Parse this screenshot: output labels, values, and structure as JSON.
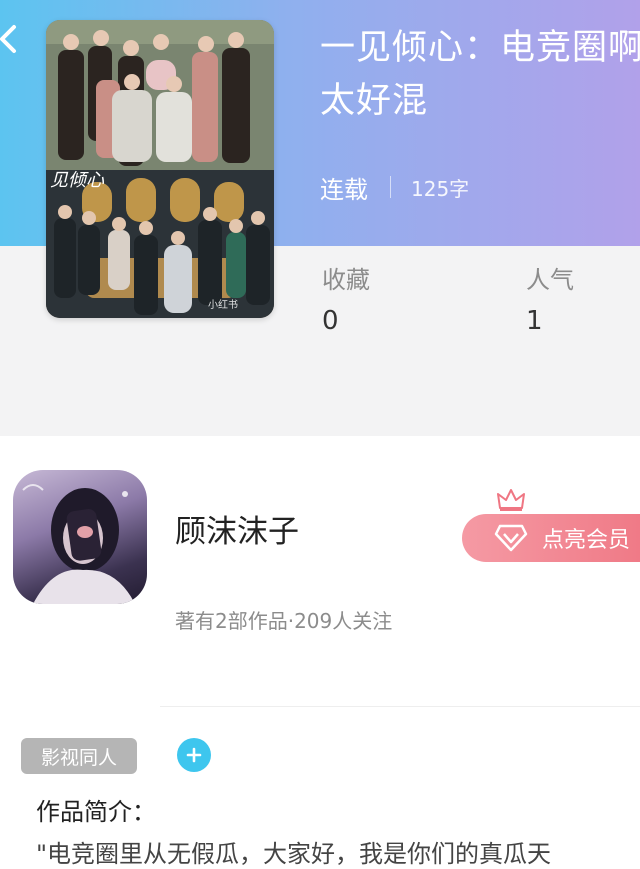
{
  "header": {
    "back_icon": "chevron-left-icon",
    "title": "一见倾心：电竞圈啊太好混",
    "status": "连载",
    "word_count": "125字"
  },
  "cover": {
    "calligraphy_text": "见倾心",
    "watermark": "小红书"
  },
  "stats": {
    "favorites_label": "收藏",
    "favorites_value": "0",
    "popularity_label": "人气",
    "popularity_value": "1"
  },
  "author": {
    "name": "顾沫沫子",
    "meta": "著有2部作品·209人关注",
    "vip_label": "点亮会员",
    "vip_icons": [
      "crown-icon",
      "diamond-icon"
    ]
  },
  "tags": {
    "items": [
      "影视同人"
    ],
    "add_icon": "plus-icon"
  },
  "intro": {
    "heading": "作品简介：",
    "text": "\"电竞圈里从无假瓜，大家好，我是你们的真瓜天"
  },
  "colors": {
    "header_gradient_start": "#5cc4f0",
    "header_gradient_end": "#b1a1ea",
    "vip_pink": "#ef7683",
    "accent_blue": "#3ec6ee",
    "tag_gray": "#b5b5b5"
  }
}
